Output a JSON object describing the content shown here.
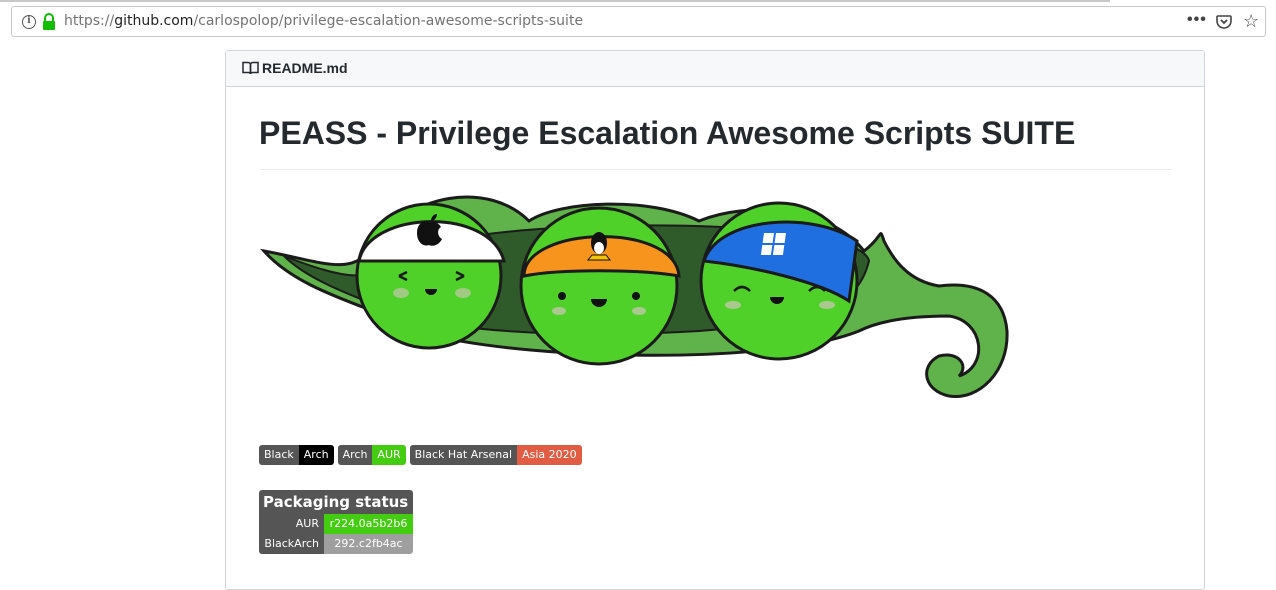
{
  "browser": {
    "url_prefix": "https://",
    "url_host": "github.com",
    "url_path": "/carlospolop/privilege-escalation-awesome-scripts-suite",
    "menu_icon": "more-dots-icon",
    "pocket_icon": "pocket-icon",
    "star_icon": "bookmark-star-icon"
  },
  "readme": {
    "file_name": "README.md",
    "heading": "PEASS - Privilege Escalation Awesome Scripts SUITE"
  },
  "badges": [
    {
      "left": "Black",
      "right": "Arch",
      "right_color": "#000000"
    },
    {
      "left": "Arch",
      "right": "AUR",
      "right_color": "#4c1"
    },
    {
      "left": "Black Hat Arsenal",
      "right": "Asia 2020",
      "right_color": "#e05d44"
    }
  ],
  "packaging": {
    "title": "Packaging status",
    "rows": [
      {
        "repo": "AUR",
        "version": "r224.0a5b2b6",
        "color": "#4c1"
      },
      {
        "repo": "BlackArch",
        "version": "292.c2fb4ac",
        "color": "#9f9f9f"
      }
    ]
  },
  "colors": {
    "pod_green": "#5fb34a",
    "pea_green": "#4fd12a",
    "orange_band": "#f7941d",
    "blue_band": "#1f6fe0"
  }
}
